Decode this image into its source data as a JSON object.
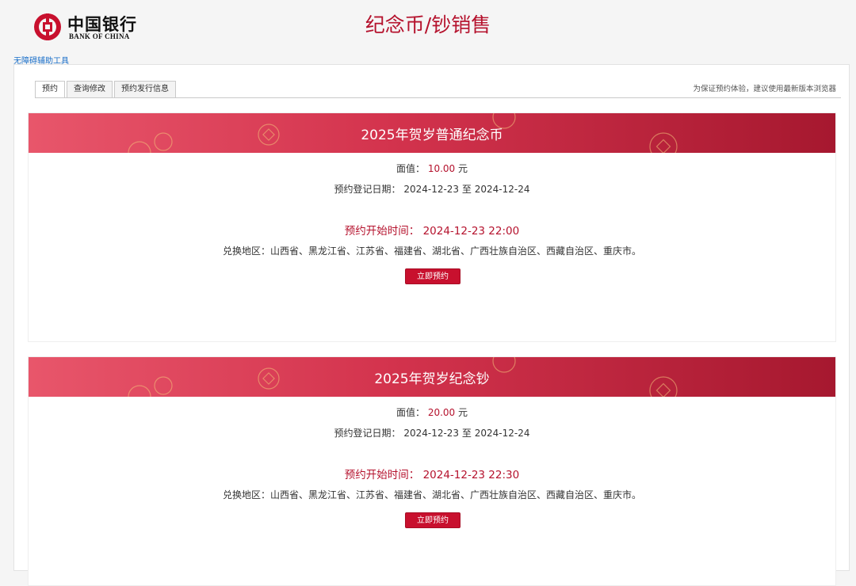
{
  "logo": {
    "cn": "中国银行",
    "en": "BANK OF CHINA"
  },
  "page_title": "纪念币/钞销售",
  "a11y_link": "无障碍辅助工具",
  "tabs": [
    {
      "label": "预约"
    },
    {
      "label": "查询修改"
    },
    {
      "label": "预约发行信息"
    }
  ],
  "notice": "为保证预约体验，建议使用最新版本浏览器",
  "cards": [
    {
      "title": "2025年贺岁普通纪念币",
      "face_label": "面值：",
      "face_value": "10.00",
      "face_unit": "元",
      "reg_label": "预约登记日期：",
      "reg_start": "2024-12-23",
      "reg_to": "至",
      "reg_end": "2024-12-24",
      "start_label": "预约开始时间：",
      "start_time": "2024-12-23 22:00",
      "region_label": "兑换地区：",
      "regions": "山西省、黑龙江省、江苏省、福建省、湖北省、广西壮族自治区、西藏自治区、重庆市。",
      "button": "立即预约"
    },
    {
      "title": "2025年贺岁纪念钞",
      "face_label": "面值：",
      "face_value": "20.00",
      "face_unit": "元",
      "reg_label": "预约登记日期：",
      "reg_start": "2024-12-23",
      "reg_to": "至",
      "reg_end": "2024-12-24",
      "start_label": "预约开始时间：",
      "start_time": "2024-12-23 22:30",
      "region_label": "兑换地区：",
      "regions": "山西省、黑龙江省、江苏省、福建省、湖北省、广西壮族自治区、西藏自治区、重庆市。",
      "button": "立即预约"
    }
  ],
  "colors": {
    "brand": "#c8102e",
    "title": "#b5122d",
    "link": "#1a6fc9"
  }
}
